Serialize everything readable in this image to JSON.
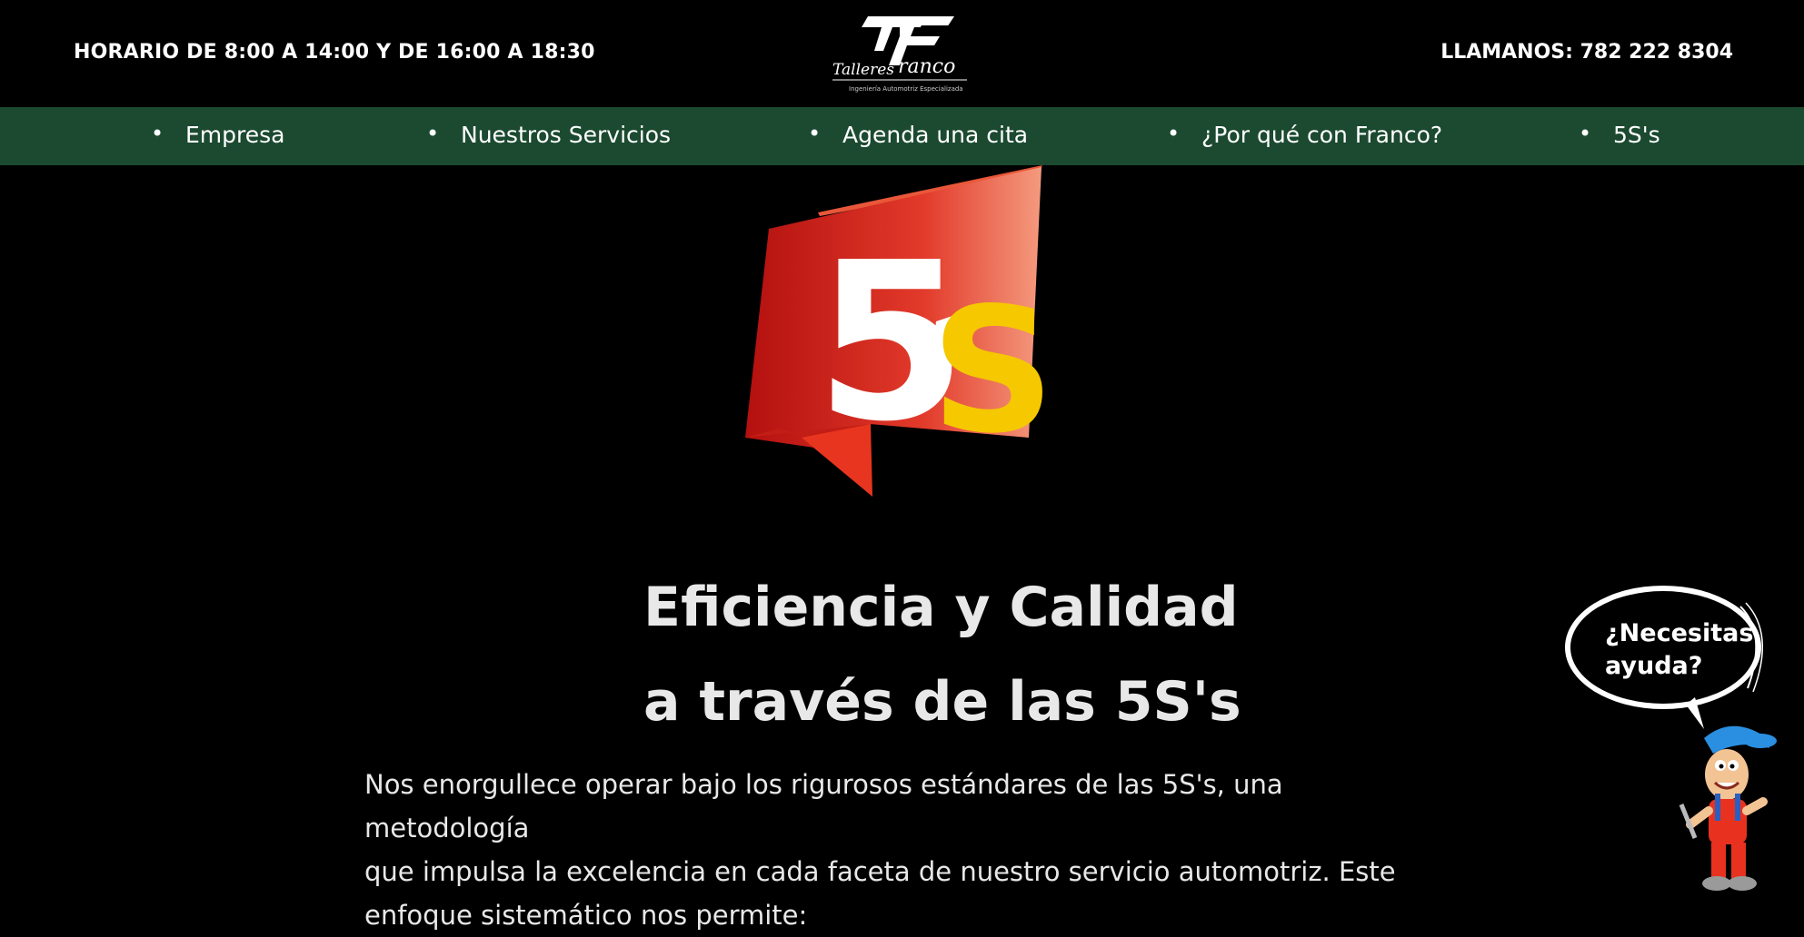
{
  "header": {
    "hours": "HORARIO DE 8:00 A 14:00 Y DE 16:00 A 18:30",
    "phone": "LLAMANOS: 782 222 8304",
    "logo_text": "Talleres Franco",
    "logo_tagline": "Ingeniería Automotriz Especializada"
  },
  "nav": {
    "items": [
      "Empresa",
      "Nuestros Servicios",
      "Agenda una cita",
      "¿Por qué con Franco?",
      "5S's"
    ]
  },
  "hero": {
    "badge_number": "5",
    "badge_suffix": "S"
  },
  "content": {
    "headline_line1": "Eficiencia y Calidad",
    "headline_line2": "a través de las 5S's",
    "paragraph_line1": "Nos enorgullece operar bajo los rigurosos estándares de las 5S's, una metodología",
    "paragraph_line2": "que impulsa la excelencia en cada faceta de nuestro servicio automotriz. Este",
    "paragraph_line3": "enfoque sistemático nos permite:"
  },
  "help": {
    "line1": "¿Necesitas",
    "line2": "ayuda?"
  },
  "colors": {
    "nav_bg": "#1b4a30",
    "page_bg": "#000000",
    "badge_red": "#d8261c",
    "badge_yellow": "#f5c800"
  }
}
